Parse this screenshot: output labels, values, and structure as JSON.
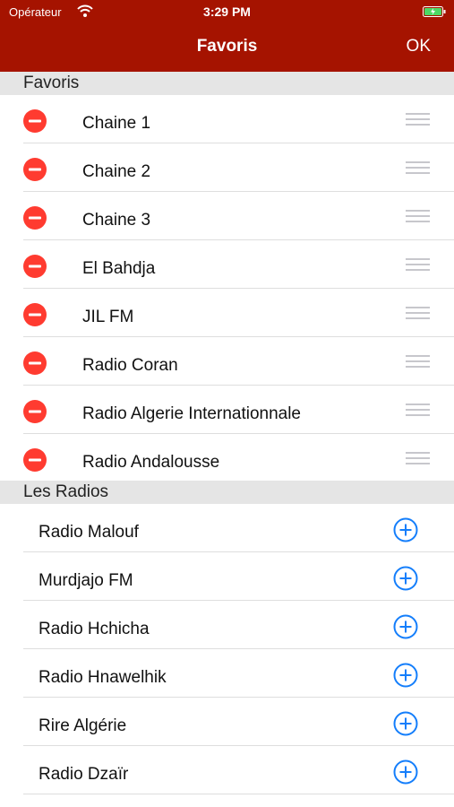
{
  "status_bar": {
    "carrier": "Opérateur",
    "time": "3:29 PM"
  },
  "nav": {
    "title": "Favoris",
    "ok_label": "OK"
  },
  "favorites": {
    "header": "Favoris",
    "items": [
      {
        "label": "Chaine 1"
      },
      {
        "label": "Chaine 2"
      },
      {
        "label": "Chaine 3"
      },
      {
        "label": "El Bahdja"
      },
      {
        "label": "JIL FM"
      },
      {
        "label": "Radio Coran"
      },
      {
        "label": "Radio Algerie Internationnale"
      },
      {
        "label": "Radio Andalousse"
      }
    ]
  },
  "radios": {
    "header": "Les Radios",
    "items": [
      {
        "label": "Radio Malouf"
      },
      {
        "label": "Murdjajo FM"
      },
      {
        "label": "Radio Hchicha"
      },
      {
        "label": "Radio Hnawelhik"
      },
      {
        "label": "Rire Algérie"
      },
      {
        "label": "Radio Dzaïr"
      }
    ]
  },
  "colors": {
    "nav_bar": "#a51300",
    "delete": "#ff3b30",
    "add": "#147efb",
    "section_bg": "#e5e5e5"
  },
  "icons": {
    "delete": "minus-circle-icon",
    "add": "plus-circle-icon",
    "reorder": "reorder-handle-icon"
  }
}
